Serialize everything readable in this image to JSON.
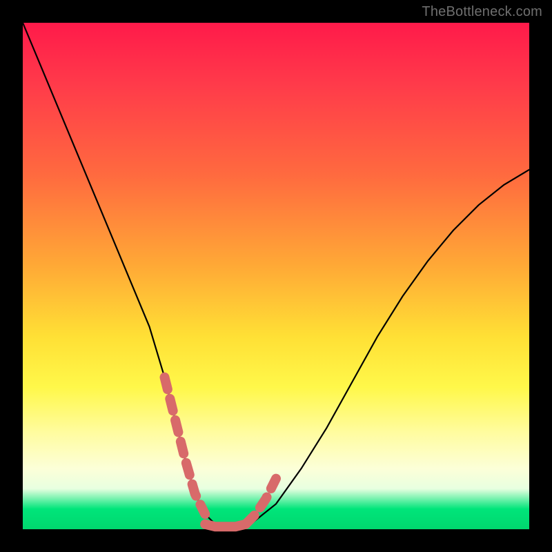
{
  "watermark": {
    "text": "TheBottleneck.com"
  },
  "chart_data": {
    "type": "line",
    "title": "",
    "xlabel": "",
    "ylabel": "",
    "xlim": [
      0,
      100
    ],
    "ylim": [
      0,
      100
    ],
    "curve": {
      "x": [
        0,
        5,
        10,
        15,
        20,
        25,
        28,
        30,
        32,
        34,
        36,
        38,
        40,
        42,
        45,
        50,
        55,
        60,
        65,
        70,
        75,
        80,
        85,
        90,
        95,
        100
      ],
      "y": [
        100,
        88,
        76,
        64,
        52,
        40,
        30,
        22,
        14,
        7,
        3,
        1,
        0,
        0,
        1,
        5,
        12,
        20,
        29,
        38,
        46,
        53,
        59,
        64,
        68,
        71
      ]
    },
    "thick_marker_segments": [
      {
        "x": [
          28,
          30,
          32,
          34,
          36
        ],
        "y": [
          30,
          22,
          14,
          7,
          3
        ]
      },
      {
        "x": [
          36,
          38,
          40,
          42,
          44
        ],
        "y": [
          1,
          0.5,
          0.5,
          0.5,
          1
        ]
      },
      {
        "x": [
          44,
          46,
          48,
          50
        ],
        "y": [
          1,
          3,
          6,
          10
        ]
      }
    ],
    "colors": {
      "curve": "#000000",
      "marker": "#d86a6a",
      "background_top": "#ff1a4a",
      "background_bottom": "#00d76e"
    }
  }
}
